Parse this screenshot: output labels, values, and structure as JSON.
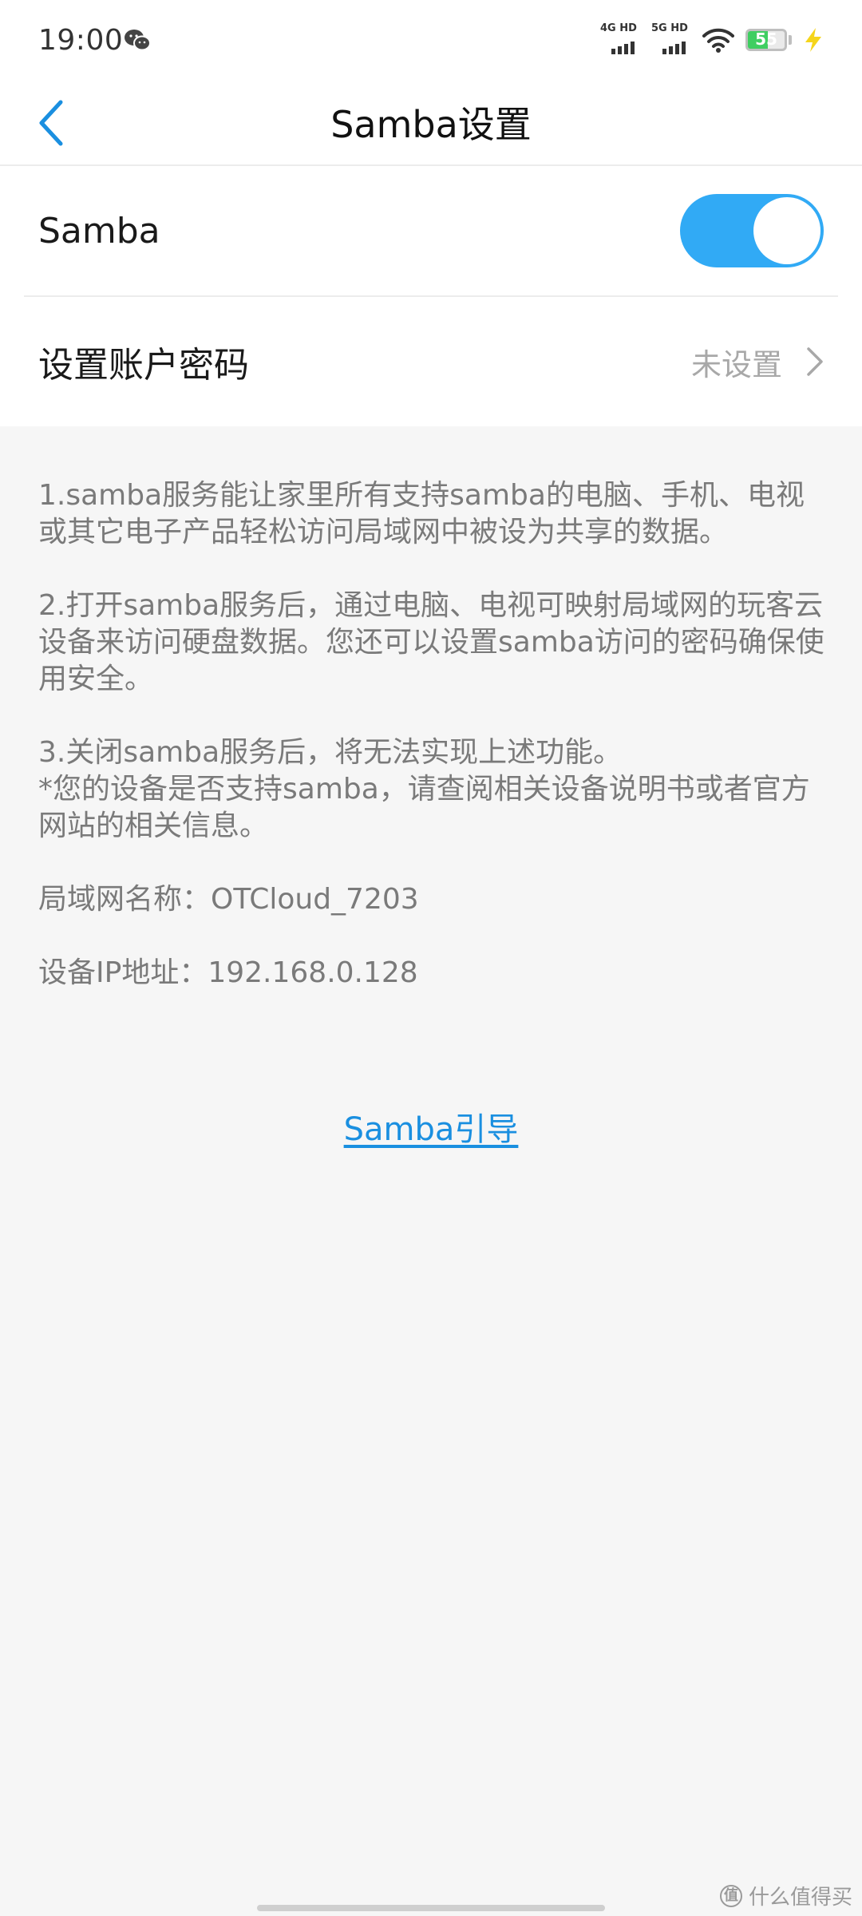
{
  "status_bar": {
    "time": "19:00",
    "notification_icon": "wechat-icon",
    "signal_1_label": "4G HD",
    "signal_2_label": "5G HD",
    "battery_level": "55",
    "battery_fraction": 0.55,
    "charging": true
  },
  "nav": {
    "title": "Samba设置",
    "back_icon": "chevron-left-icon"
  },
  "settings": {
    "samba_label": "Samba",
    "samba_enabled": true,
    "password_label": "设置账户密码",
    "password_value": "未设置"
  },
  "info": {
    "p1": "1.samba服务能让家里所有支持samba的电脑、手机、电视或其它电子产品轻松访问局域网中被设为共享的数据。",
    "p2": "2.打开samba服务后，通过电脑、电视可映射局域网的玩客云设备来访问硬盘数据。您还可以设置samba访问的密码确保使用安全。",
    "p3": "3.关闭samba服务后，将无法实现上述功能。",
    "p4": "*您的设备是否支持samba，请查阅相关设备说明书或者官方网站的相关信息。",
    "lan_name": "局域网名称：OTCloud_7203",
    "device_ip": "设备IP地址：192.168.0.128"
  },
  "guide_link": "Samba引导",
  "watermark": {
    "logo_text": "值",
    "text": "什么值得买"
  },
  "colors": {
    "accent": "#31aaf5",
    "link": "#1a8fe0",
    "background": "#f6f6f6",
    "secondary_text": "#7a7a7a"
  }
}
